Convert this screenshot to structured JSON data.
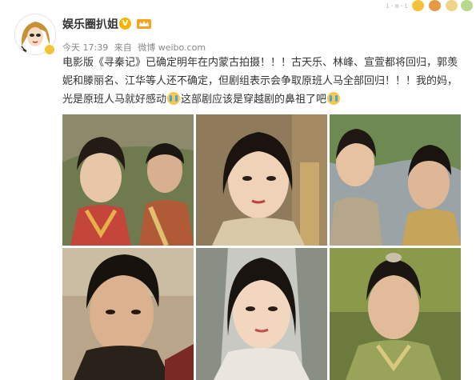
{
  "header": {
    "username": "娱乐圈扒姐",
    "verified_badge": "V",
    "time": "今天 17:39",
    "source_prefix": "来自",
    "source": "微博 weibo.com"
  },
  "post": {
    "text_part1": "电影版《寻秦记》已确定明年在内蒙古拍摄！！！古天乐、林峰、宣萱都将回归，郭羡妮和滕丽名、江华等人还不确定，但剧组表示会争取原班人马全部回归！！！我的妈，光是原班人马就好感动",
    "text_part2": "这部剧应该是穿越剧的鼻祖了吧"
  },
  "icons": {
    "verified": "verified-v-icon",
    "crown": "crown-badge-icon",
    "crying": "crying-face-emoji-icon"
  },
  "photos": [
    {
      "id": "photo-1"
    },
    {
      "id": "photo-2"
    },
    {
      "id": "photo-3"
    },
    {
      "id": "photo-4"
    },
    {
      "id": "photo-5"
    },
    {
      "id": "photo-6"
    }
  ],
  "colors": {
    "verified_badge": "#f4b400",
    "text": "#333333",
    "meta": "#888888"
  }
}
